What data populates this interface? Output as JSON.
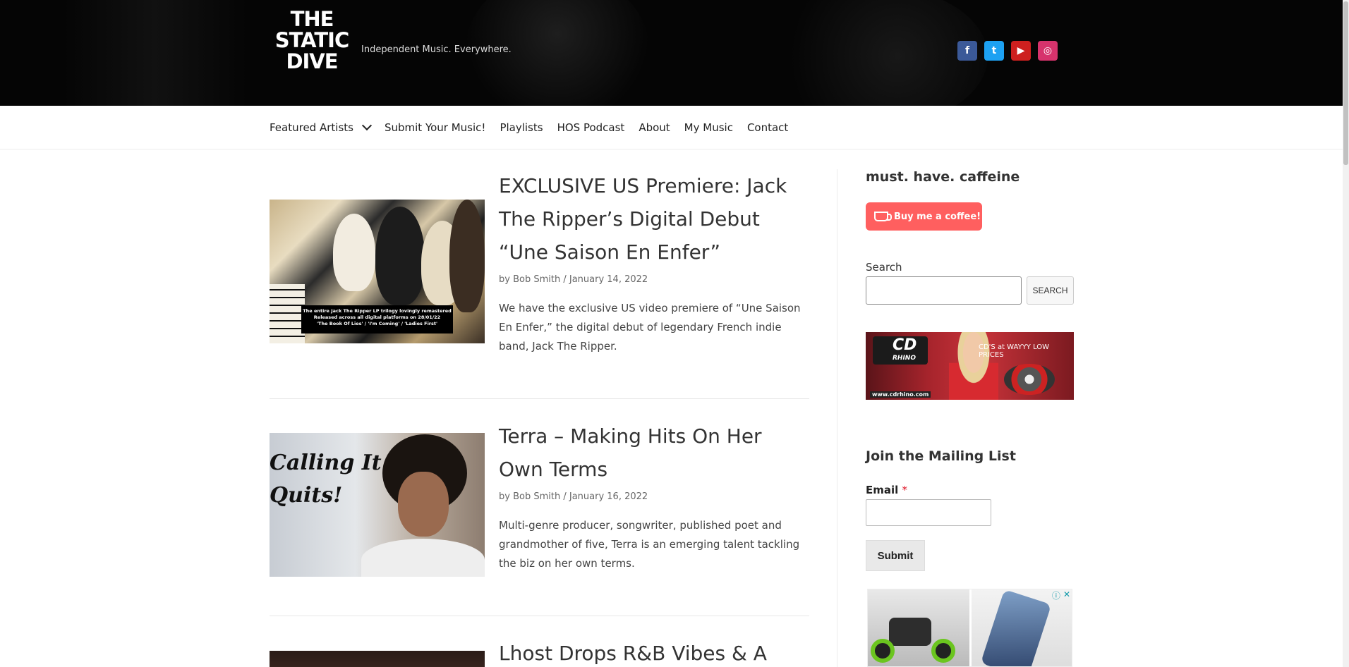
{
  "header": {
    "logo_lines": [
      "THE",
      "STATIC",
      "DIVE"
    ],
    "tagline": "Independent Music. Everywhere.",
    "socials": [
      {
        "name": "facebook",
        "glyph": "f"
      },
      {
        "name": "twitter",
        "glyph": "t"
      },
      {
        "name": "youtube",
        "glyph": "▶"
      },
      {
        "name": "instagram",
        "glyph": "◎"
      }
    ]
  },
  "nav": {
    "items": [
      "Featured Artists",
      "Submit Your Music!",
      "Playlists",
      "HOS Podcast",
      "About",
      "My Music",
      "Contact"
    ]
  },
  "posts": [
    {
      "title": "EXCLUSIVE US Premiere: Jack The Ripper’s Digital Debut “Une Saison En Enfer”",
      "meta_prefix": "by",
      "author": "Bob Smith",
      "date": "January 14, 2022",
      "excerpt": "We have the exclusive US video premiere of “Une Saison En Enfer,” the digital debut of legendary French indie band, Jack The Ripper.",
      "thumb_caption": [
        "The entire Jack The Ripper LP trilogy lovingly remastered",
        "Released across all digital platforms on 28/01/22",
        "'The Book Of Lies' / 'I'm Coming' / 'Ladies First'"
      ]
    },
    {
      "title": "Terra – Making Hits On Her Own Terms",
      "meta_prefix": "by",
      "author": "Bob Smith",
      "date": "January 16, 2022",
      "excerpt": "Multi-genre producer, songwriter, published poet and grandmother of five, Terra is an emerging talent tackling the biz on her own terms.",
      "thumb_text": [
        "Calling It",
        "Quits!"
      ]
    },
    {
      "title": "Lhost Drops R&B Vibes & A"
    }
  ],
  "sidebar": {
    "caffeine_title": "must. have. caffeine",
    "coffee_label": "Buy me a coffee!",
    "search_label": "Search",
    "search_button": "SEARCH",
    "cd_ad": {
      "brand": "CD",
      "brand_sub": "RHINO",
      "tag": "CD'S at WAYYY LOW PRICES",
      "url": "www.cdrhino.com"
    },
    "mailing_title": "Join the Mailing List",
    "email_label": "Email",
    "required_mark": "*",
    "submit_label": "Submit",
    "ad_controls": [
      "ⓘ",
      "✕"
    ]
  }
}
